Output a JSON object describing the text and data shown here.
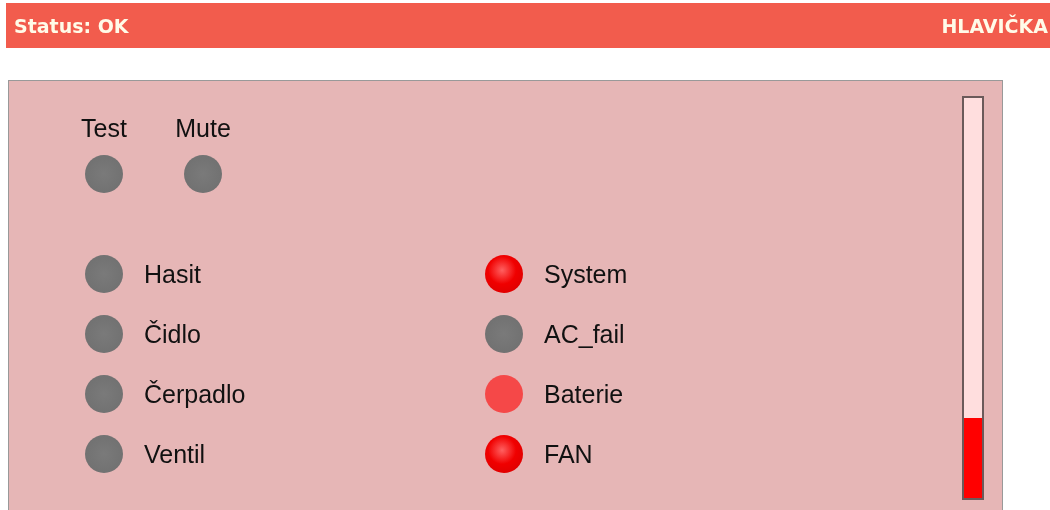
{
  "header": {
    "status": "Status: OK",
    "title": "HLAVIČKA"
  },
  "buttons": [
    {
      "label": "Test",
      "on": false
    },
    {
      "label": "Mute",
      "on": false
    }
  ],
  "indicator_columns": [
    [
      {
        "label": "Hasit",
        "on": false,
        "blinking": false
      },
      {
        "label": "Čidlo",
        "on": false,
        "blinking": false
      },
      {
        "label": "Čerpadlo",
        "on": false,
        "blinking": false
      },
      {
        "label": "Ventil",
        "on": false,
        "blinking": false
      }
    ],
    [
      {
        "label": "System",
        "on": true,
        "blinking": false
      },
      {
        "label": "AC_fail",
        "on": false,
        "blinking": false
      },
      {
        "label": "Baterie",
        "on": true,
        "blinking": true
      },
      {
        "label": "FAN",
        "on": true,
        "blinking": false
      }
    ]
  ],
  "meter": {
    "level": 0.2
  }
}
